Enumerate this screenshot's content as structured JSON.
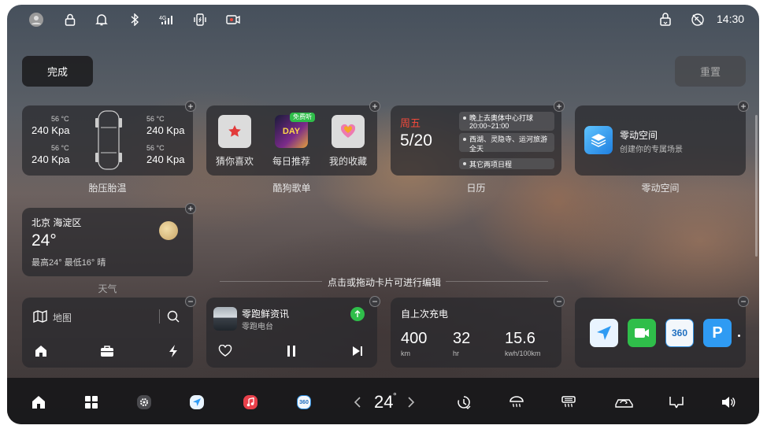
{
  "status_bar": {
    "time": "14:30"
  },
  "top": {
    "done_label": "完成",
    "reset_label": "重置"
  },
  "tire": {
    "title": "胎压胎温",
    "fl_temp": "56 °C",
    "fl_pressure": "240 Kpa",
    "fr_temp": "56 °C",
    "fr_pressure": "240 Kpa",
    "rl_temp": "56 °C",
    "rl_pressure": "240 Kpa",
    "rr_temp": "56 °C",
    "rr_pressure": "240 Kpa"
  },
  "kugou": {
    "title": "酷狗歌单",
    "items": [
      {
        "label": "猜你喜欢"
      },
      {
        "label": "每日推荐",
        "badge": "免费听",
        "cover_text": "DAY"
      },
      {
        "label": "我的收藏"
      }
    ]
  },
  "calendar": {
    "title": "日历",
    "weekday": "周五",
    "date": "5/20",
    "events": [
      {
        "line1": "晚上去奥体中心打球",
        "line2": "20:00~21:00"
      },
      {
        "line1": "西湖、灵隐寺、运河旅游",
        "line2": "全天"
      },
      {
        "line1": "其它两项日程",
        "line2": ""
      }
    ]
  },
  "zero": {
    "title": "零动空间",
    "name": "零动空间",
    "subtitle": "创建你的专属场景"
  },
  "weather": {
    "title": "天气",
    "location": "北京 海淀区",
    "temp": "24°",
    "summary": "最高24° 最低16° 晴"
  },
  "hint": "点击或拖动卡片可进行编辑",
  "map": {
    "search_label": "地图"
  },
  "radio": {
    "title": "零跑鲜资讯",
    "subtitle": "零跑电台"
  },
  "charge": {
    "title": "自上次充电",
    "distance": "400",
    "distance_unit": "km",
    "hours": "32",
    "hours_unit": "hr",
    "consumption": "15.6",
    "consumption_unit": "kwh/100km"
  },
  "apps": {
    "app3_text": "360",
    "app4_text": "P"
  },
  "dock": {
    "temperature": "24",
    "temp_unit": "°",
    "app_360_text": "360"
  },
  "colors": {
    "accent": "#2f9bf3",
    "calendar_red": "#f0493b",
    "green": "#2fbe4a"
  }
}
